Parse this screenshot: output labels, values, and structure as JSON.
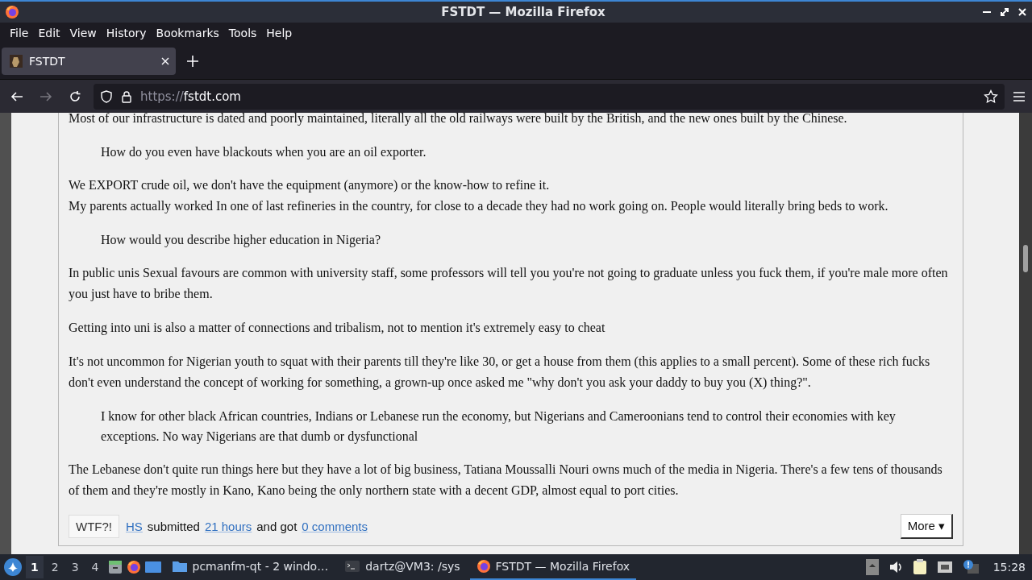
{
  "window": {
    "title": "FSTDT — Mozilla Firefox"
  },
  "menu": [
    "File",
    "Edit",
    "View",
    "History",
    "Bookmarks",
    "Tools",
    "Help"
  ],
  "tabs": [
    {
      "label": "FSTDT",
      "selected": true
    }
  ],
  "address": {
    "scheme": "https://",
    "host": "fstdt.com"
  },
  "post": {
    "blocks": [
      {
        "kind": "para",
        "lines": [
          "Most of our infrastructure is dated and poorly maintained, literally all the old railways were built by the British, and the new ones built by the Chinese."
        ]
      },
      {
        "kind": "quote",
        "lines": [
          "How do you even have blackouts when you are an oil exporter."
        ]
      },
      {
        "kind": "para",
        "lines": [
          "We EXPORT crude oil, we don't have the equipment (anymore) or the know-how to refine it.",
          "My parents actually worked In one of last refineries in the country, for close to a decade they had no work going on. People would literally bring beds to work."
        ]
      },
      {
        "kind": "quote",
        "lines": [
          "How would you describe higher education in Nigeria?"
        ]
      },
      {
        "kind": "para",
        "lines": [
          "In public unis Sexual favours are common with university staff, some professors will tell you you're not going to graduate unless you fuck them, if you're male more often you just have to bribe them."
        ]
      },
      {
        "kind": "para",
        "lines": [
          "Getting into uni is also a matter of connections and tribalism, not to mention it's extremely easy to cheat"
        ]
      },
      {
        "kind": "para",
        "lines": [
          "It's not uncommon for Nigerian youth to squat with their parents till they're like 30, or get a house from them (this applies to a small percent). Some of these rich fucks don't even understand the concept of working for something, a grown-up once asked me \"why don't you ask your daddy to buy you (X) thing?\"."
        ]
      },
      {
        "kind": "quote",
        "lines": [
          "I know for other black African countries, Indians or Lebanese run the economy, but Nigerians and Cameroonians tend to control their economies with key exceptions. No way Nigerians are that dumb or dysfunctional"
        ]
      },
      {
        "kind": "para",
        "lines": [
          "The Lebanese don't quite run things here but they have a lot of big business, Tatiana Moussalli Nouri owns much of the media in Nigeria. There's a few tens of thousands of them and they're mostly in Kano, Kano being the only northern state with a decent GDP, almost equal to port cities."
        ]
      }
    ],
    "footer": {
      "badge": "WTF?!",
      "author": "HS",
      "submitted": "submitted",
      "time": "21 hours",
      "got": "and got",
      "comments": "0 comments",
      "more": "More ▾"
    }
  },
  "taskbar": {
    "workspaces": [
      {
        "label": "1",
        "selected": true
      },
      {
        "label": "2",
        "selected": false
      },
      {
        "label": "3",
        "selected": false
      },
      {
        "label": "4",
        "selected": false
      }
    ],
    "windows": [
      {
        "label": "pcmanfm-qt - 2 windo…",
        "kind": "folder",
        "selected": false
      },
      {
        "label": "dartz@VM3: /sys",
        "kind": "terminal",
        "selected": false
      },
      {
        "label": "FSTDT — Mozilla Firefox",
        "kind": "firefox",
        "selected": true
      }
    ],
    "clock": "15:28"
  }
}
